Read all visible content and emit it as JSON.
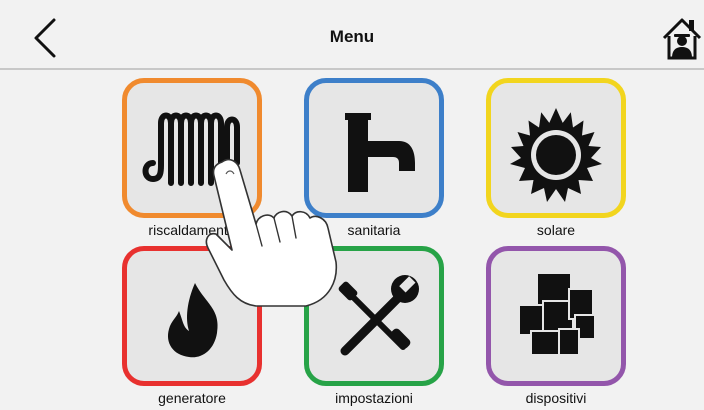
{
  "header": {
    "title": "Menu",
    "back_icon": "chevron-left-icon",
    "home_icon": "home-user-icon"
  },
  "tiles": [
    {
      "label": "riscaldamento",
      "icon": "radiator-icon",
      "color": "#f08a2e"
    },
    {
      "label": "sanitaria",
      "icon": "faucet-icon",
      "color": "#3d7fc9"
    },
    {
      "label": "solare",
      "icon": "sun-icon",
      "color": "#f2d51e"
    },
    {
      "label": "generatore",
      "icon": "flame-icon",
      "color": "#e8312f"
    },
    {
      "label": "impostazioni",
      "icon": "tools-icon",
      "color": "#27a347"
    },
    {
      "label": "dispositivi",
      "icon": "devices-icon",
      "color": "#9356ab"
    }
  ],
  "overlay": {
    "icon": "pointing-hand-icon"
  }
}
